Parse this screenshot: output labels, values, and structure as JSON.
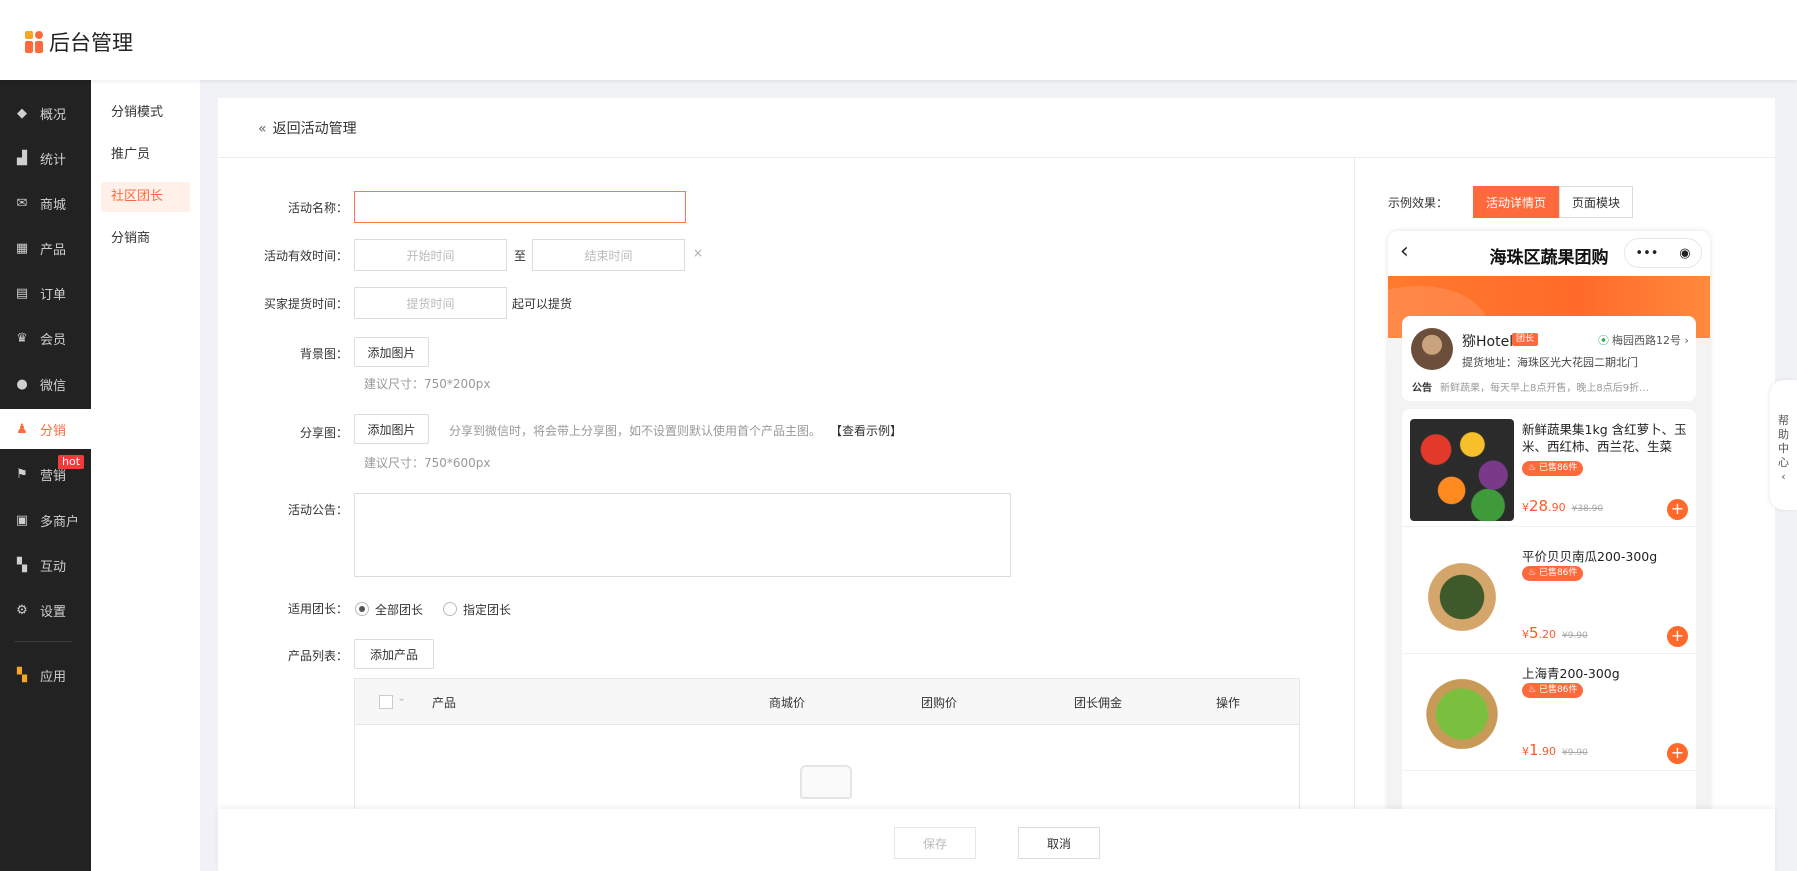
{
  "app": {
    "logo_text": "后台管理"
  },
  "nav": {
    "items": [
      {
        "label": "概况",
        "icon": "layers-icon"
      },
      {
        "label": "统计",
        "icon": "chart-icon"
      },
      {
        "label": "商城",
        "icon": "mail-icon"
      },
      {
        "label": "产品",
        "icon": "grid-icon"
      },
      {
        "label": "订单",
        "icon": "clipboard-icon"
      },
      {
        "label": "会员",
        "icon": "crown-icon"
      },
      {
        "label": "微信",
        "icon": "wechat-icon"
      },
      {
        "label": "分销",
        "icon": "user-icon"
      },
      {
        "label": "营销",
        "icon": "flag-icon"
      },
      {
        "label": "多商户",
        "icon": "store-icon"
      },
      {
        "label": "互动",
        "icon": "interact-icon"
      },
      {
        "label": "设置",
        "icon": "gear-icon"
      },
      {
        "label": "应用",
        "icon": "apps-icon"
      }
    ],
    "hot_badge": "hot",
    "accent": "#ff6a3d"
  },
  "subnav": {
    "items": [
      "分销模式",
      "推广员",
      "社区团长",
      "分销商"
    ]
  },
  "page": {
    "back_label": "返回活动管理"
  },
  "form": {
    "name_label": "活动名称：",
    "valid_label": "活动有效时间：",
    "start_placeholder": "开始时间",
    "to": "至",
    "end_placeholder": "结束时间",
    "clear": "×",
    "pickup_label": "买家提货时间：",
    "pickup_placeholder": "提货时间",
    "pickup_suffix": "起可以提货",
    "bg_label": "背景图：",
    "add_image": "添加图片",
    "bg_hint": "建议尺寸：750*200px",
    "share_label": "分享图：",
    "share_tip": "分享到微信时，将会带上分享图，如不设置则默认使用首个产品主图。",
    "share_example": "【查看示例】",
    "share_hint": "建议尺寸：750*600px",
    "notice_label": "活动公告：",
    "leader_label": "适用团长：",
    "leader_all": "全部团长",
    "leader_specific": "指定团长",
    "products_label": "产品列表：",
    "add_product": "添加产品"
  },
  "table": {
    "columns": [
      "产品",
      "商城价",
      "团购价",
      "团长佣金",
      "操作"
    ]
  },
  "footer": {
    "save": "保存",
    "cancel": "取消"
  },
  "preview": {
    "label": "示例效果：",
    "tabs": [
      "活动详情页",
      "页面模块"
    ],
    "title": "海珠区蔬果团购",
    "leader": {
      "name": "猕Hotel",
      "badge": "团长",
      "location": "梅园西路12号",
      "address": "提货地址：海珠区光大花园二期北门",
      "notice_tag": "公告",
      "notice": "新鲜蔬果，每天早上8点开售，晚上8点后9折…"
    },
    "products": [
      {
        "name": "新鲜蔬果集1kg 含红萝卜、玉米、西红柿、西兰花、生菜",
        "sold": "已售86件",
        "price_int": "28",
        "price_dec": ".90",
        "orig": "¥38.90"
      },
      {
        "name": "平价贝贝南瓜200-300g",
        "sold": "已售86件",
        "price_int": "5",
        "price_dec": ".20",
        "orig": "¥9.90"
      },
      {
        "name": "上海青200-300g",
        "sold": "已售86件",
        "price_int": "1",
        "price_dec": ".90",
        "orig": "¥9.90"
      }
    ],
    "currency": "¥"
  },
  "help": {
    "label": "帮助中心"
  }
}
